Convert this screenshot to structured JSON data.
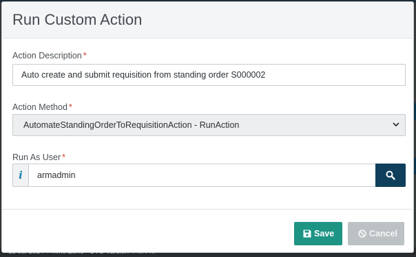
{
  "background": {
    "bottom_text": "13 Jul 2024   ▾   Time Zone   ·   UTC Varsion ·PM PM"
  },
  "modal": {
    "title": "Run Custom Action"
  },
  "fields": {
    "description": {
      "label": "Action Description",
      "required_mark": "*",
      "value": "Auto create and submit requisition from standing order S000002"
    },
    "method": {
      "label": "Action Method",
      "required_mark": "*",
      "selected": "AutomateStandingOrderToRequisitionAction - RunAction",
      "chevron": "⌄"
    },
    "run_as": {
      "label": "Run As User",
      "required_mark": "*",
      "addon": "i",
      "value": "armadmin"
    }
  },
  "footer": {
    "save_label": "Save",
    "cancel_label": "Cancel"
  },
  "icons": {
    "info": "info-icon",
    "search": "search-icon",
    "save": "floppy-disk-icon",
    "cancel": "ban-icon"
  },
  "colors": {
    "save": "#1e9484",
    "cancel_disabled": "#bcc1c4",
    "search": "#0f3f5a",
    "required": "#d9362a",
    "info": "#1b82b3"
  }
}
